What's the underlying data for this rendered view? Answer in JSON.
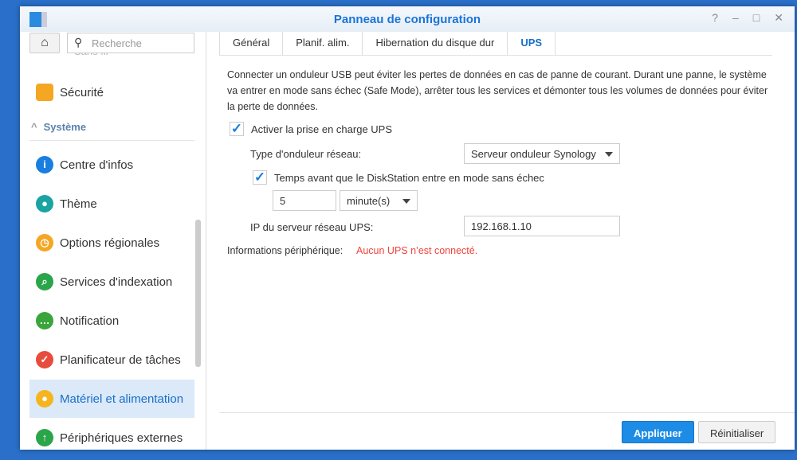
{
  "window": {
    "title": "Panneau de configuration",
    "help": "?",
    "minimize": "–",
    "maximize": "□",
    "close": "✕"
  },
  "sidebar": {
    "search_placeholder": "Recherche",
    "partial_item": "Sans fil",
    "section": "Système",
    "items": [
      {
        "label": "Sécurité",
        "color": "#f5a623",
        "glyph": "⛨"
      },
      {
        "label": "Centre d'infos",
        "color": "#1a7ee0",
        "glyph": "i"
      },
      {
        "label": "Thème",
        "color": "#1aa3a3",
        "glyph": "●"
      },
      {
        "label": "Options régionales",
        "color": "#f5a623",
        "glyph": "◷"
      },
      {
        "label": "Services d'indexation",
        "color": "#2aa54a",
        "glyph": "⌕"
      },
      {
        "label": "Notification",
        "color": "#3aa53a",
        "glyph": "…"
      },
      {
        "label": "Planificateur de tâches",
        "color": "#e74c3c",
        "glyph": "✓"
      },
      {
        "label": "Matériel et alimentation",
        "color": "#f5b520",
        "glyph": "●"
      },
      {
        "label": "Périphériques externes",
        "color": "#2aa54a",
        "glyph": "↑"
      }
    ],
    "selected": "Matériel et alimentation"
  },
  "tabs": [
    "Général",
    "Planif. alim.",
    "Hibernation du disque dur",
    "UPS"
  ],
  "active_tab": "UPS",
  "content": {
    "description": "Connecter un onduleur USB peut éviter les pertes de données en cas de panne de courant. Durant une panne, le système va entrer en mode sans échec (Safe Mode), arrêter tous les services et démonter tous les volumes de données pour éviter la perte de données.",
    "enable_ups": {
      "label": "Activer la prise en charge UPS",
      "checked": true
    },
    "ups_type_label": "Type d'onduleur réseau:",
    "ups_type_value": "Serveur onduleur Synology",
    "safe_mode": {
      "label": "Temps avant que le DiskStation entre en mode sans échec",
      "checked": true
    },
    "time_value": "5",
    "time_unit": "minute(s)",
    "ip_label": "IP du serveur réseau UPS:",
    "ip_value": "192.168.1.10",
    "info_label": "Informations périphérique:",
    "info_status": "Aucun UPS n’est connecté.",
    "status_color": "#f0433a"
  },
  "footer": {
    "apply": "Appliquer",
    "reset": "Réinitialiser"
  }
}
